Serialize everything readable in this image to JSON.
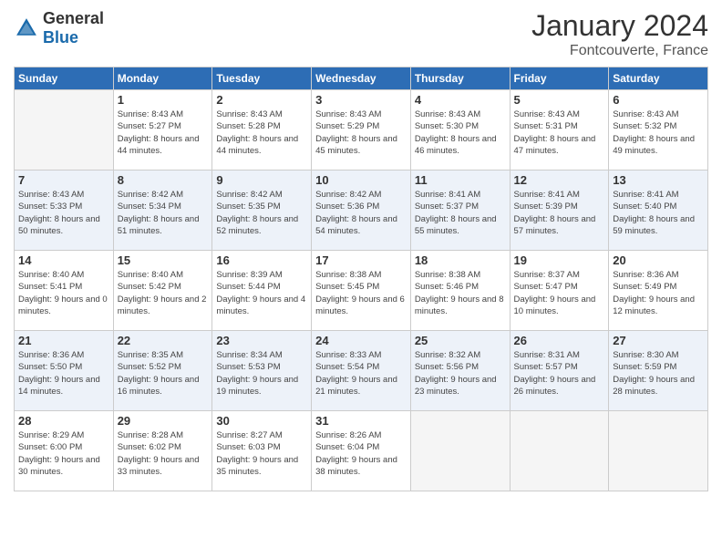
{
  "header": {
    "logo_general": "General",
    "logo_blue": "Blue",
    "month": "January 2024",
    "location": "Fontcouverte, France"
  },
  "weekdays": [
    "Sunday",
    "Monday",
    "Tuesday",
    "Wednesday",
    "Thursday",
    "Friday",
    "Saturday"
  ],
  "weeks": [
    [
      {
        "num": "",
        "empty": true
      },
      {
        "num": "1",
        "sunrise": "Sunrise: 8:43 AM",
        "sunset": "Sunset: 5:27 PM",
        "daylight": "Daylight: 8 hours and 44 minutes."
      },
      {
        "num": "2",
        "sunrise": "Sunrise: 8:43 AM",
        "sunset": "Sunset: 5:28 PM",
        "daylight": "Daylight: 8 hours and 44 minutes."
      },
      {
        "num": "3",
        "sunrise": "Sunrise: 8:43 AM",
        "sunset": "Sunset: 5:29 PM",
        "daylight": "Daylight: 8 hours and 45 minutes."
      },
      {
        "num": "4",
        "sunrise": "Sunrise: 8:43 AM",
        "sunset": "Sunset: 5:30 PM",
        "daylight": "Daylight: 8 hours and 46 minutes."
      },
      {
        "num": "5",
        "sunrise": "Sunrise: 8:43 AM",
        "sunset": "Sunset: 5:31 PM",
        "daylight": "Daylight: 8 hours and 47 minutes."
      },
      {
        "num": "6",
        "sunrise": "Sunrise: 8:43 AM",
        "sunset": "Sunset: 5:32 PM",
        "daylight": "Daylight: 8 hours and 49 minutes."
      }
    ],
    [
      {
        "num": "7",
        "sunrise": "Sunrise: 8:43 AM",
        "sunset": "Sunset: 5:33 PM",
        "daylight": "Daylight: 8 hours and 50 minutes."
      },
      {
        "num": "8",
        "sunrise": "Sunrise: 8:42 AM",
        "sunset": "Sunset: 5:34 PM",
        "daylight": "Daylight: 8 hours and 51 minutes."
      },
      {
        "num": "9",
        "sunrise": "Sunrise: 8:42 AM",
        "sunset": "Sunset: 5:35 PM",
        "daylight": "Daylight: 8 hours and 52 minutes."
      },
      {
        "num": "10",
        "sunrise": "Sunrise: 8:42 AM",
        "sunset": "Sunset: 5:36 PM",
        "daylight": "Daylight: 8 hours and 54 minutes."
      },
      {
        "num": "11",
        "sunrise": "Sunrise: 8:41 AM",
        "sunset": "Sunset: 5:37 PM",
        "daylight": "Daylight: 8 hours and 55 minutes."
      },
      {
        "num": "12",
        "sunrise": "Sunrise: 8:41 AM",
        "sunset": "Sunset: 5:39 PM",
        "daylight": "Daylight: 8 hours and 57 minutes."
      },
      {
        "num": "13",
        "sunrise": "Sunrise: 8:41 AM",
        "sunset": "Sunset: 5:40 PM",
        "daylight": "Daylight: 8 hours and 59 minutes."
      }
    ],
    [
      {
        "num": "14",
        "sunrise": "Sunrise: 8:40 AM",
        "sunset": "Sunset: 5:41 PM",
        "daylight": "Daylight: 9 hours and 0 minutes."
      },
      {
        "num": "15",
        "sunrise": "Sunrise: 8:40 AM",
        "sunset": "Sunset: 5:42 PM",
        "daylight": "Daylight: 9 hours and 2 minutes."
      },
      {
        "num": "16",
        "sunrise": "Sunrise: 8:39 AM",
        "sunset": "Sunset: 5:44 PM",
        "daylight": "Daylight: 9 hours and 4 minutes."
      },
      {
        "num": "17",
        "sunrise": "Sunrise: 8:38 AM",
        "sunset": "Sunset: 5:45 PM",
        "daylight": "Daylight: 9 hours and 6 minutes."
      },
      {
        "num": "18",
        "sunrise": "Sunrise: 8:38 AM",
        "sunset": "Sunset: 5:46 PM",
        "daylight": "Daylight: 9 hours and 8 minutes."
      },
      {
        "num": "19",
        "sunrise": "Sunrise: 8:37 AM",
        "sunset": "Sunset: 5:47 PM",
        "daylight": "Daylight: 9 hours and 10 minutes."
      },
      {
        "num": "20",
        "sunrise": "Sunrise: 8:36 AM",
        "sunset": "Sunset: 5:49 PM",
        "daylight": "Daylight: 9 hours and 12 minutes."
      }
    ],
    [
      {
        "num": "21",
        "sunrise": "Sunrise: 8:36 AM",
        "sunset": "Sunset: 5:50 PM",
        "daylight": "Daylight: 9 hours and 14 minutes."
      },
      {
        "num": "22",
        "sunrise": "Sunrise: 8:35 AM",
        "sunset": "Sunset: 5:52 PM",
        "daylight": "Daylight: 9 hours and 16 minutes."
      },
      {
        "num": "23",
        "sunrise": "Sunrise: 8:34 AM",
        "sunset": "Sunset: 5:53 PM",
        "daylight": "Daylight: 9 hours and 19 minutes."
      },
      {
        "num": "24",
        "sunrise": "Sunrise: 8:33 AM",
        "sunset": "Sunset: 5:54 PM",
        "daylight": "Daylight: 9 hours and 21 minutes."
      },
      {
        "num": "25",
        "sunrise": "Sunrise: 8:32 AM",
        "sunset": "Sunset: 5:56 PM",
        "daylight": "Daylight: 9 hours and 23 minutes."
      },
      {
        "num": "26",
        "sunrise": "Sunrise: 8:31 AM",
        "sunset": "Sunset: 5:57 PM",
        "daylight": "Daylight: 9 hours and 26 minutes."
      },
      {
        "num": "27",
        "sunrise": "Sunrise: 8:30 AM",
        "sunset": "Sunset: 5:59 PM",
        "daylight": "Daylight: 9 hours and 28 minutes."
      }
    ],
    [
      {
        "num": "28",
        "sunrise": "Sunrise: 8:29 AM",
        "sunset": "Sunset: 6:00 PM",
        "daylight": "Daylight: 9 hours and 30 minutes."
      },
      {
        "num": "29",
        "sunrise": "Sunrise: 8:28 AM",
        "sunset": "Sunset: 6:02 PM",
        "daylight": "Daylight: 9 hours and 33 minutes."
      },
      {
        "num": "30",
        "sunrise": "Sunrise: 8:27 AM",
        "sunset": "Sunset: 6:03 PM",
        "daylight": "Daylight: 9 hours and 35 minutes."
      },
      {
        "num": "31",
        "sunrise": "Sunrise: 8:26 AM",
        "sunset": "Sunset: 6:04 PM",
        "daylight": "Daylight: 9 hours and 38 minutes."
      },
      {
        "num": "",
        "empty": true
      },
      {
        "num": "",
        "empty": true
      },
      {
        "num": "",
        "empty": true
      }
    ]
  ]
}
